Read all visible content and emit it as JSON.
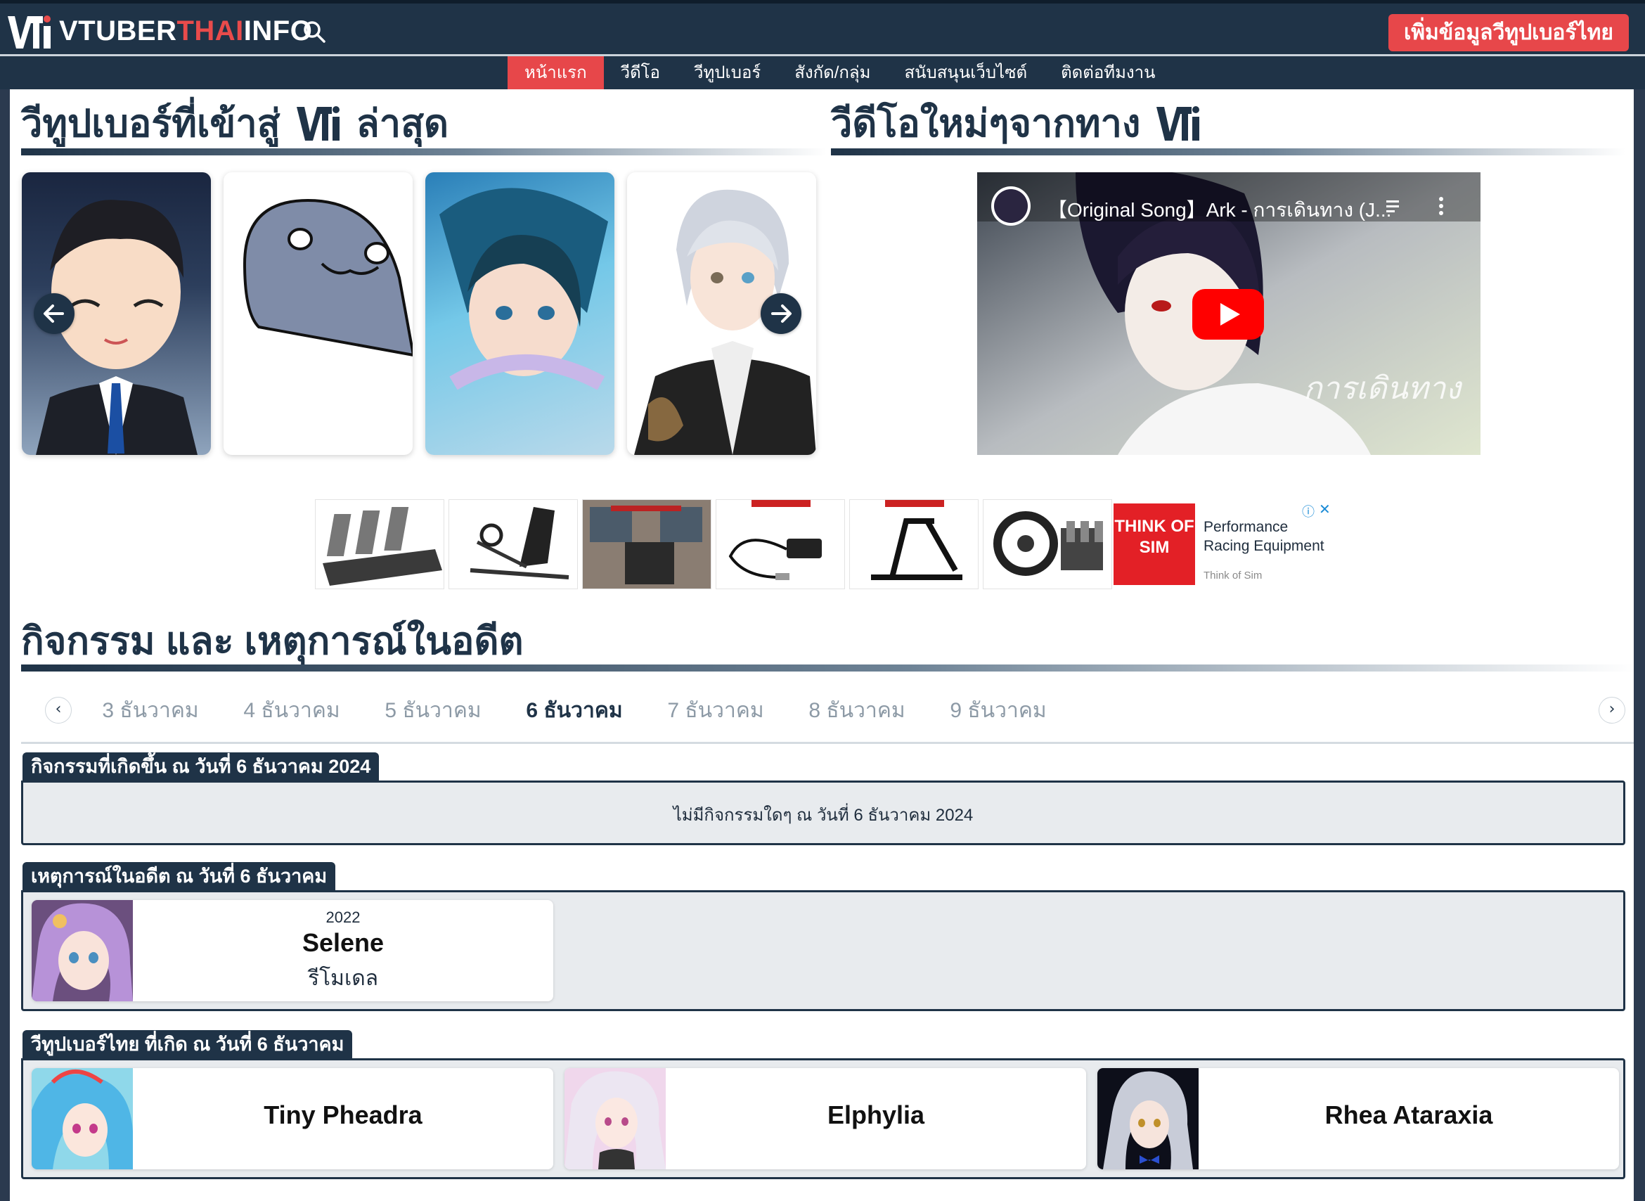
{
  "site": {
    "logo_text_1": "VTUBER",
    "logo_text_2": "THAI",
    "logo_text_3": "INFO",
    "add_button": "เพิ่มข้อมูลวีทูปเบอร์ไทย"
  },
  "nav": {
    "items": [
      "หน้าแรก",
      "วีดีโอ",
      "วีทูปเบอร์",
      "สังกัด/กลุ่ม",
      "สนับสนุนเว็บไซต์",
      "ติดต่อทีมงาน"
    ],
    "active_index": 0
  },
  "sections": {
    "latest_vtubers": "วีทูปเบอร์ที่เข้าสู่",
    "latest_vtubers_suffix": "ล่าสุด",
    "new_videos": "วีดีโอใหม่ๆจากทาง",
    "events": "กิจกรรม และ เหตุการณ์ในอดีต"
  },
  "video": {
    "title": "【Original Song】Ark - การเดินทาง (J...",
    "overlay": "การเดินทาง"
  },
  "ad": {
    "brand": "THINK OF SIM",
    "headline_1": "Performance",
    "headline_2": "Racing Equipment",
    "advertiser": "Think of Sim",
    "info_icon": "ⓘ",
    "close_icon": "✕"
  },
  "dates": {
    "items": [
      "3 ธันวาคม",
      "4 ธันวาคม",
      "5 ธันวาคม",
      "6 ธันวาคม",
      "7 ธันวาคม",
      "8 ธันวาคม",
      "9 ธันวาคม"
    ],
    "active_index": 3,
    "prev": "‹",
    "next": "›"
  },
  "activities": {
    "label": "กิจกรรมที่เกิดขึ้น ณ วันที่ 6 ธันวาคม 2024",
    "empty_text": "ไม่มีกิจกรรมใดๆ ณ วันที่ 6 ธันวาคม 2024"
  },
  "past_events": {
    "label": "เหตุการณ์ในอดีต ณ วันที่ 6 ธันวาคม",
    "items": [
      {
        "year": "2022",
        "name": "Selene",
        "type": "รีโมเดล"
      }
    ]
  },
  "birthdays": {
    "label": "วีทูปเบอร์ไทย ที่เกิด ณ วันที่ 6 ธันวาคม",
    "items": [
      "Tiny Pheadra",
      "Elphylia",
      "Rhea Ataraxia"
    ]
  },
  "colors": {
    "navy": "#1f3347",
    "accent_red": "#e7474a"
  }
}
